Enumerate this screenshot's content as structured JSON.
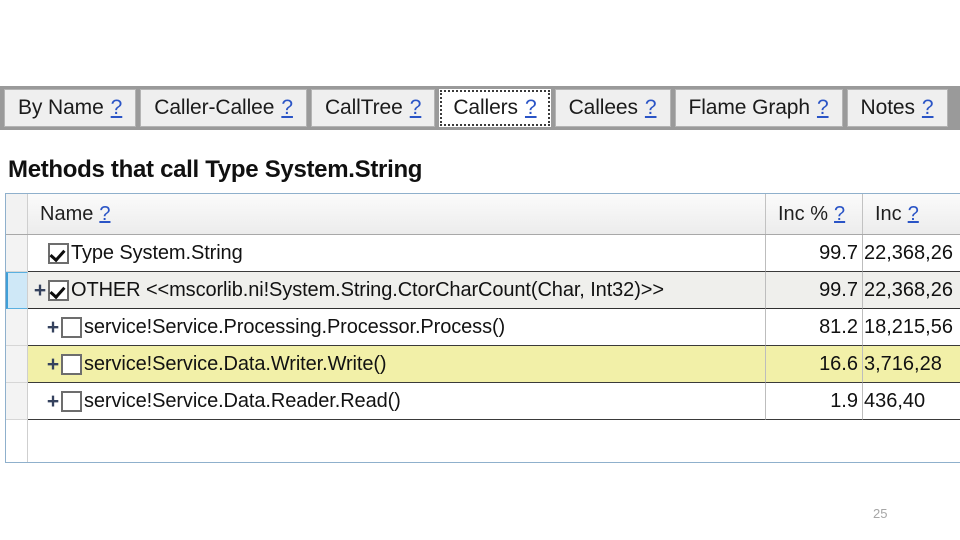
{
  "tabs": [
    {
      "label": "By Name",
      "help": "?",
      "selected": false
    },
    {
      "label": "Caller-Callee",
      "help": "?",
      "selected": false
    },
    {
      "label": "CallTree",
      "help": "?",
      "selected": false
    },
    {
      "label": "Callers",
      "help": "?",
      "selected": true
    },
    {
      "label": "Callees",
      "help": "?",
      "selected": false
    },
    {
      "label": "Flame Graph",
      "help": "?",
      "selected": false
    },
    {
      "label": "Notes",
      "help": "?",
      "selected": false
    }
  ],
  "heading": "Methods that call Type System.String",
  "grid": {
    "columns": [
      {
        "label": "Name",
        "help": "?"
      },
      {
        "label": "Inc %",
        "help": "?"
      },
      {
        "label": "Inc",
        "help": "?"
      }
    ],
    "rows": [
      {
        "name": "Type System.String",
        "inc_pct": "99.7",
        "inc": "22,368,26",
        "checked": true,
        "expander": "",
        "indent": 0,
        "state": "normal",
        "gutter_selected": false
      },
      {
        "name": "OTHER <<mscorlib.ni!System.String.CtorCharCount(Char, Int32)>>",
        "inc_pct": "99.7",
        "inc": "22,368,26",
        "checked": true,
        "expander": "+",
        "indent": 0,
        "state": "alt",
        "gutter_selected": true
      },
      {
        "name": "service!Service.Processing.Processor.Process()",
        "inc_pct": "81.2",
        "inc": "18,215,56",
        "checked": false,
        "expander": "+",
        "indent": 1,
        "state": "normal",
        "gutter_selected": false
      },
      {
        "name": "service!Service.Data.Writer.Write()",
        "inc_pct": "16.6",
        "inc": "3,716,28",
        "checked": false,
        "expander": "+",
        "indent": 1,
        "state": "hl",
        "gutter_selected": false
      },
      {
        "name": "service!Service.Data.Reader.Read()",
        "inc_pct": "1.9",
        "inc": "436,40",
        "checked": false,
        "expander": "+",
        "indent": 1,
        "state": "normal",
        "gutter_selected": false
      }
    ]
  },
  "page_number": "25",
  "colors": {
    "tabstrip_bg": "#9a9a9a",
    "tab_bg": "#efefef",
    "selected_tab_bg": "#ffffff",
    "help_link": "#2a54c6",
    "highlight_row": "#f2f0a8",
    "alt_row": "#efefec",
    "gutter_selected": "#cfe8f7",
    "grid_border": "#8fb0cc"
  }
}
